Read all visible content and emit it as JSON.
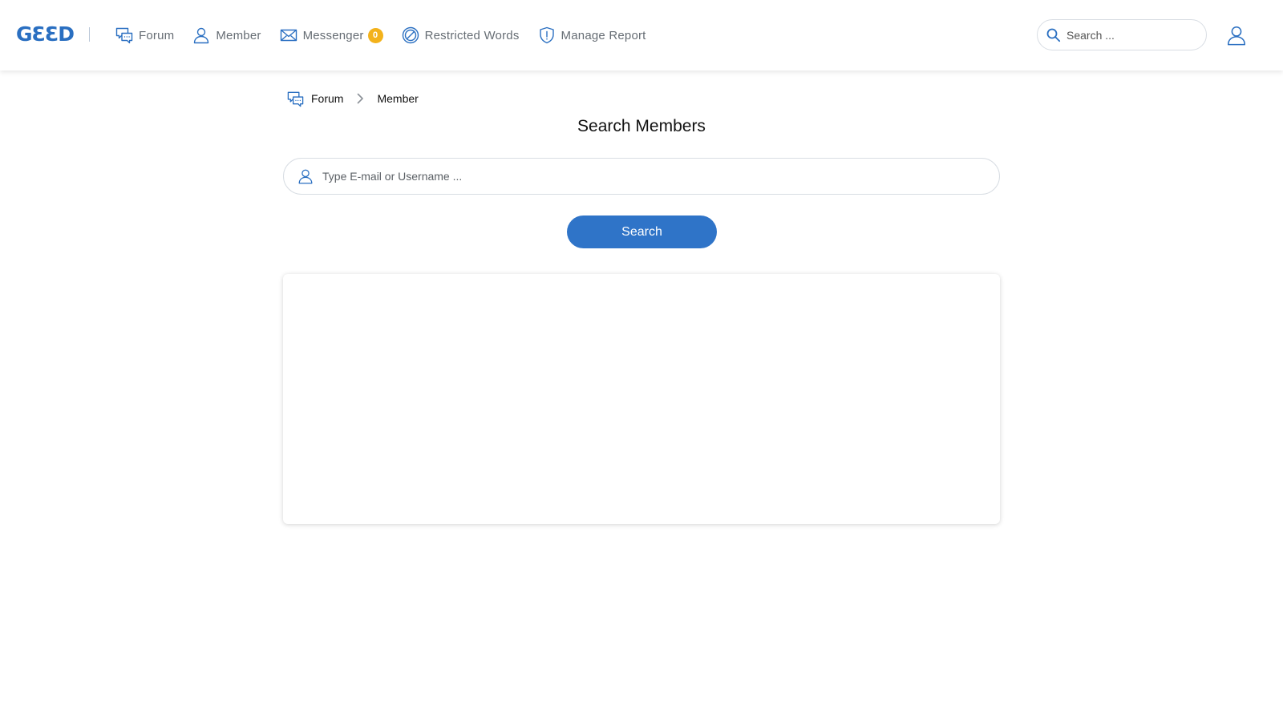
{
  "header": {
    "logo_text": "GƐƐD",
    "nav": [
      {
        "label": "Forum",
        "icon": "forum-chat-icon"
      },
      {
        "label": "Member",
        "icon": "member-user-icon"
      },
      {
        "label": "Messenger",
        "icon": "mail-envelope-icon",
        "badge": "0"
      },
      {
        "label": "Restricted Words",
        "icon": "restricted-circle-icon"
      },
      {
        "label": "Manage Report",
        "icon": "shield-report-icon"
      }
    ],
    "search": {
      "placeholder": "Search ..."
    },
    "user_icon": "user-account-icon"
  },
  "breadcrumb": {
    "items": [
      {
        "label": "Forum",
        "icon": "forum-chat-icon"
      },
      {
        "label": "Member"
      }
    ]
  },
  "main": {
    "title": "Search Members",
    "search_input": {
      "placeholder": "Type E-mail or Username ...",
      "value": ""
    },
    "search_button_label": "Search"
  },
  "colors": {
    "accent": "#2f74c8",
    "icon_blue": "#2a6fc1",
    "badge": "#f3b21b",
    "nav_text": "#666d74"
  }
}
